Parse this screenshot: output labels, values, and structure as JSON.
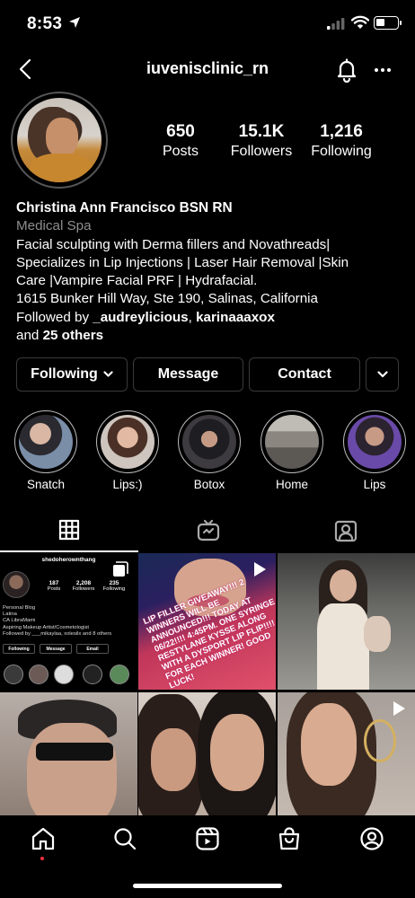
{
  "status_bar": {
    "time": "8:53"
  },
  "header": {
    "username": "iuvenisclinic_rn"
  },
  "profile": {
    "stats": [
      {
        "value": "650",
        "label": "Posts"
      },
      {
        "value": "15.1K",
        "label": "Followers"
      },
      {
        "value": "1,216",
        "label": "Following"
      }
    ],
    "name": "Christina Ann Francisco BSN RN",
    "category": "Medical Spa",
    "bio_lines": [
      "Facial sculpting with Derma fillers and Novathreads|",
      "Specializes in Lip Injections | Laser Hair Removal |Skin",
      "Care |Vampire Facial PRF | Hydrafacial.",
      "1615 Bunker Hill Way, Ste 190, Salinas, California"
    ],
    "followed_by_prefix": "Followed by ",
    "followed_by_user1": "_audreylicious",
    "followed_by_sep": ", ",
    "followed_by_user2": "karinaaaxox",
    "followed_by_and": "and ",
    "followed_by_others": "25 others"
  },
  "buttons": {
    "following": "Following",
    "message": "Message",
    "contact": "Contact"
  },
  "highlights": [
    {
      "label": "Snatch"
    },
    {
      "label": "Lips:)"
    },
    {
      "label": "Botox"
    },
    {
      "label": "Home"
    },
    {
      "label": "Lips"
    }
  ],
  "grid": {
    "post1": {
      "username": "shedoherownthang",
      "stats": [
        {
          "value": "187",
          "label": "Posts"
        },
        {
          "value": "2,208",
          "label": "Followers"
        },
        {
          "value": "235",
          "label": "Following"
        }
      ],
      "bio_lines": [
        "Personal Blog",
        "Latina",
        "CA LibraMami",
        "Aspiring Makeup Artist/Cosmetologist",
        "Followed by ___mikaylaa, xolesilx and 8 others"
      ],
      "buttons": [
        "Following",
        "Message",
        "Email"
      ]
    },
    "post2": {
      "caption": "LIP FILLER GIVEAWAY!!! 2 WINNERS WILL BE ANNOUNCED!!! TODAY AT 06/22!!!! 4:45PM. ONE SYRINGE RESTYLANE KYSSE ALONG WITH A DYSPORT LIP FLIP!!!! FOR EACH WINNER! GOOD LUCK!"
    }
  },
  "colors": {
    "background": "#000000",
    "secondary_text": "#8e8e8e",
    "button_border": "#3a3a3a",
    "notification_dot": "#ff3040"
  }
}
